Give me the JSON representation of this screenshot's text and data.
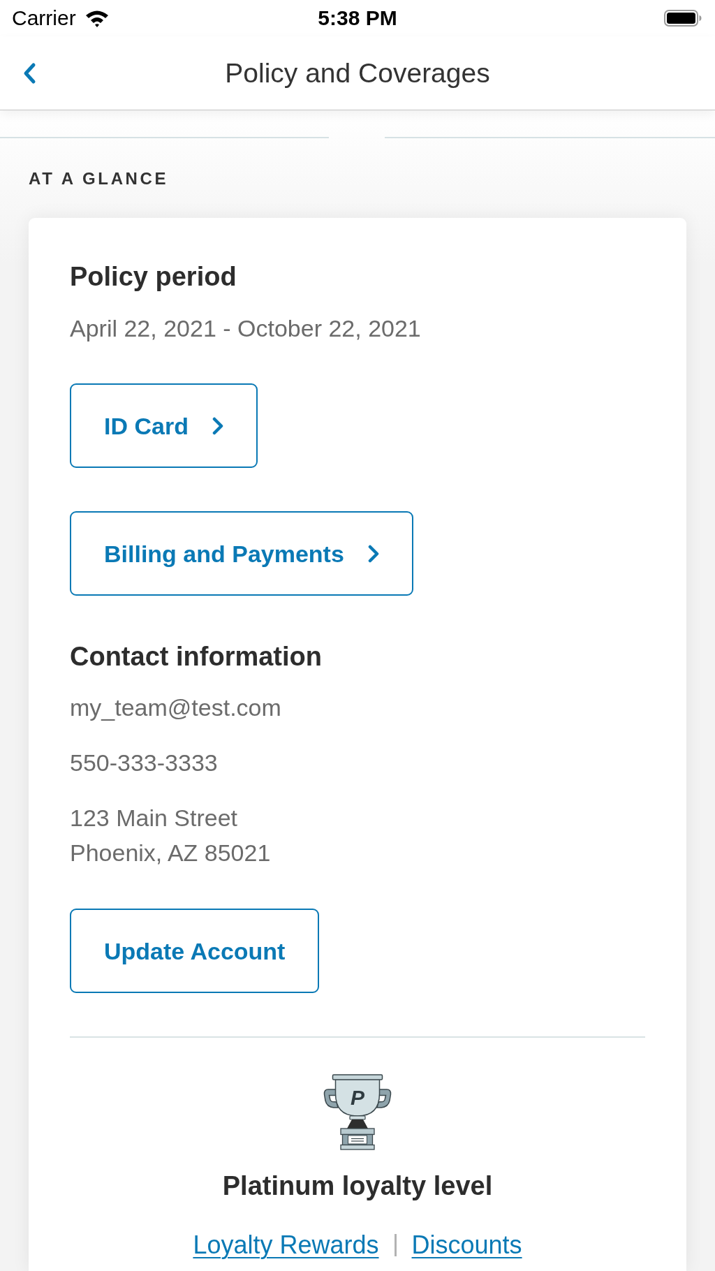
{
  "status_bar": {
    "carrier": "Carrier",
    "time": "5:38 PM"
  },
  "nav_bar": {
    "title": "Policy and Coverages"
  },
  "section": {
    "title": "AT A GLANCE"
  },
  "card": {
    "policy_period": {
      "heading": "Policy period",
      "dates": "April 22, 2021 - October 22, 2021"
    },
    "action_buttons": [
      {
        "label": "ID Card",
        "chevron": true
      },
      {
        "label": "Billing and Payments",
        "chevron": true
      }
    ],
    "contact": {
      "heading": "Contact information",
      "email": "my_team@test.com",
      "phone": "550-333-3333",
      "address": [
        "123 Main Street",
        "Phoenix, AZ 85021"
      ]
    },
    "update_button": {
      "label": "Update Account",
      "chevron": false
    },
    "loyalty": {
      "badge_letter": "P",
      "level": "Platinum loyalty level",
      "links": [
        "Loyalty Rewards",
        "Discounts"
      ]
    }
  }
}
